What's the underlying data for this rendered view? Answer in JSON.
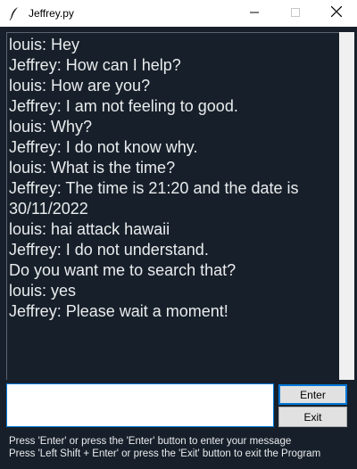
{
  "window": {
    "title": "Jeffrey.py",
    "icon": "feather-icon",
    "controls": [
      "minimize-icon",
      "maximize-icon",
      "close-icon"
    ]
  },
  "chat": {
    "lines": [
      "louis: Hey",
      "Jeffrey: How can I help?",
      "louis: How are you?",
      "Jeffrey: I am not feeling to good.",
      "louis: Why?",
      "Jeffrey: I do not know why.",
      "louis: What is the time?",
      "Jeffrey: The time is 21:20 and the date is",
      "30/11/2022",
      "louis: hai attack hawaii",
      "Jeffrey: I do not understand.",
      "Do you want me to search that?",
      "louis: yes",
      "Jeffrey: Please wait a moment!"
    ]
  },
  "input": {
    "value": "",
    "placeholder": ""
  },
  "buttons": {
    "enter_label": "Enter",
    "exit_label": "Exit"
  },
  "instructions": {
    "line1": "Press 'Enter' or press the 'Enter' button to enter your message",
    "line2": "Press 'Left Shift + Enter' or press the 'Exit' button to exit the Program"
  },
  "colors": {
    "background": "#17202a",
    "text": "#eaecee",
    "button_bg": "#e1e1e1",
    "focus_border": "#0078d7"
  }
}
